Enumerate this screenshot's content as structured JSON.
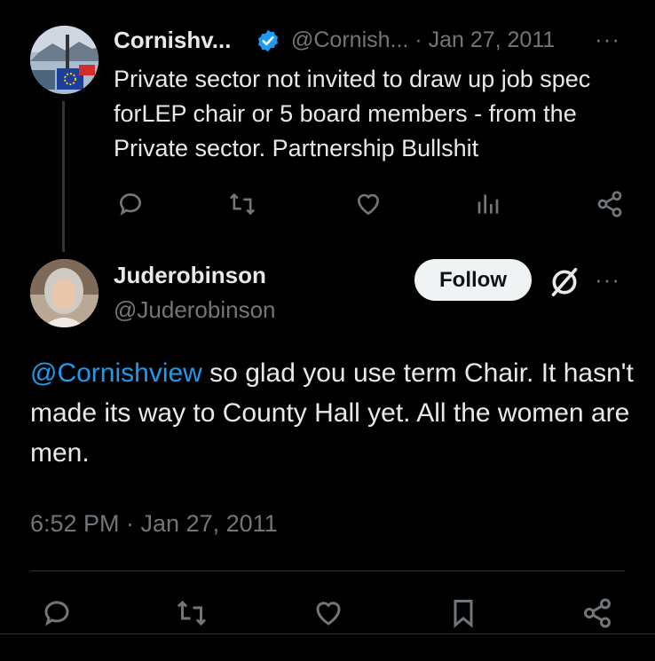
{
  "parent_tweet": {
    "display_name": "Cornishv...",
    "handle_date": "@Cornish... · Jan 27, 2011",
    "more": "···",
    "text": "Private sector not invited to draw up job spec forLEP chair or 5 board members - from the Private sector. Partnership  Bullshit",
    "actions": [
      "reply-icon",
      "retweet-icon",
      "like-icon",
      "views-icon",
      "share-icon"
    ]
  },
  "reply_tweet": {
    "display_name": "Juderobinson",
    "handle": "@Juderobinson",
    "follow_label": "Follow",
    "more": "···",
    "mention": "@Cornishview",
    "text": " so glad you use term Chair. It hasn't made its way to County Hall yet. All the women are men.",
    "timestamp": "6:52 PM · Jan 27, 2011",
    "actions": [
      "reply-icon",
      "retweet-icon",
      "like-icon",
      "bookmark-icon",
      "share-icon"
    ]
  },
  "colors": {
    "background": "#000000",
    "text": "#e7e9ea",
    "secondary": "#71767b",
    "link": "#1d9bf0",
    "verified": "#1d9bf0"
  }
}
